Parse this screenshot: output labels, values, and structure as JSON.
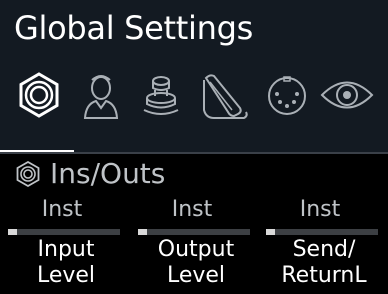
{
  "header": {
    "title": "Global Settings"
  },
  "tabs": [
    {
      "icon": "ins-outs-jack-icon",
      "selected": true
    },
    {
      "icon": "person-preferences-icon",
      "selected": false
    },
    {
      "icon": "footswitch-icon",
      "selected": false
    },
    {
      "icon": "expression-pedal-icon",
      "selected": false
    },
    {
      "icon": "midi-din-icon",
      "selected": false
    },
    {
      "icon": "eye-display-icon",
      "selected": false
    }
  ],
  "section": {
    "icon": "ins-outs-jack-icon",
    "title": "Ins/Outs"
  },
  "params": [
    {
      "value": "Inst",
      "label_line1": "Input",
      "label_line2": "Level",
      "level": 0.08
    },
    {
      "value": "Inst",
      "label_line1": "Output",
      "label_line2": "Level",
      "level": 0.08
    },
    {
      "value": "Inst",
      "label_line1": "Send/",
      "label_line2": "ReturnL",
      "level": 0.08
    }
  ],
  "colors": {
    "top_background": "#131a22",
    "body_background": "#000000",
    "accent": "#ffffff",
    "dim_text": "#bfc3c7",
    "bar_track": "#3c3f43",
    "bar_fill": "#d8d8d8"
  }
}
